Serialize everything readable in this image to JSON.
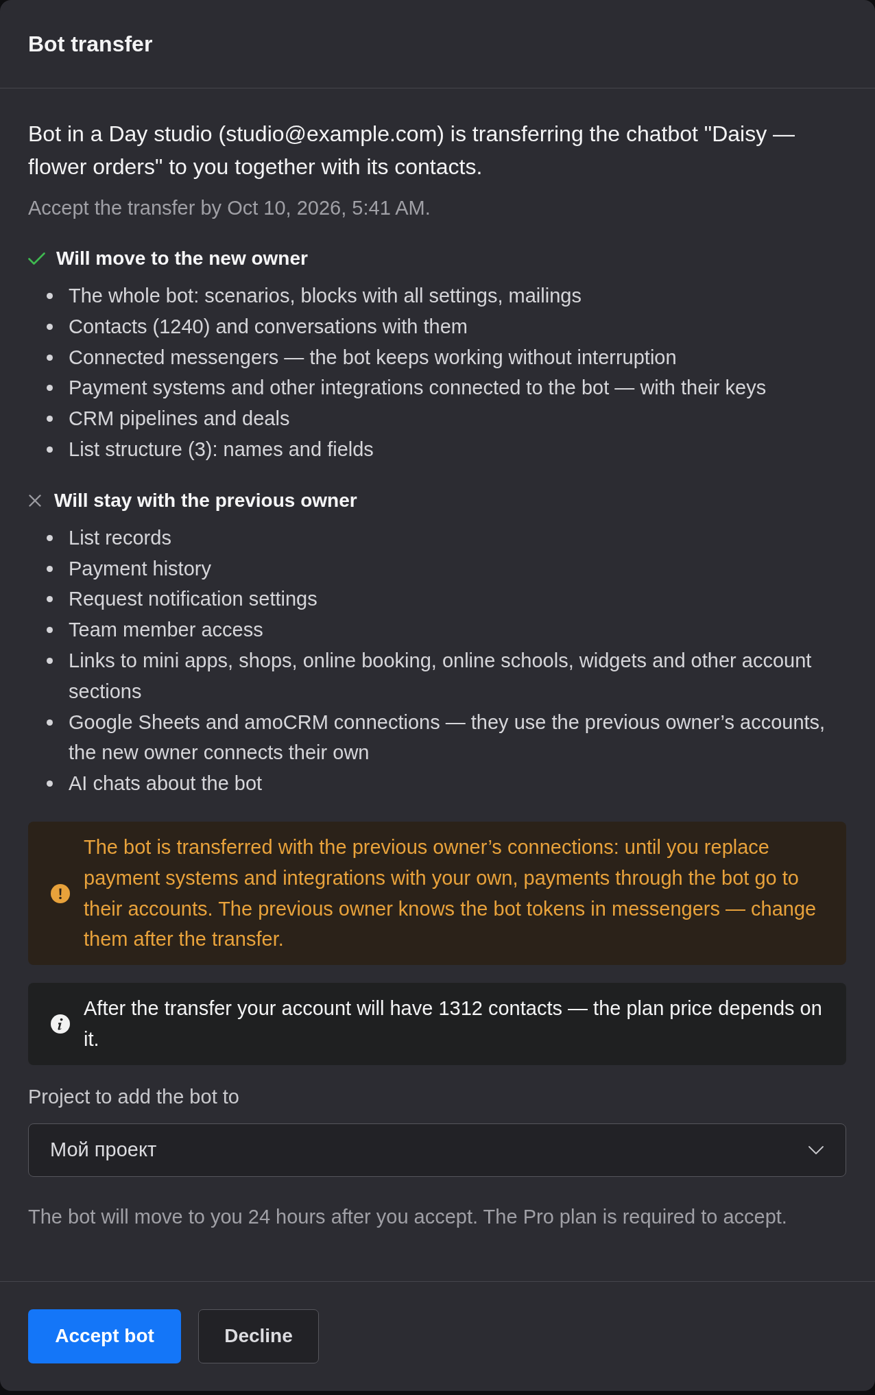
{
  "dialog": {
    "title": "Bot transfer"
  },
  "intro": {
    "message": "Bot in a Day studio (studio@example.com) is transferring the chatbot \"Daisy — flower orders\" to you together with its contacts.",
    "deadline": "Accept the transfer by Oct 10, 2026, 5:41 AM."
  },
  "sections": [
    {
      "kind": "moves",
      "heading": "Will move to the new owner",
      "items": [
        "The whole bot: scenarios, blocks with all settings, mailings",
        "Contacts (1240) and conversations with them",
        "Connected messengers — the bot keeps working without interruption",
        "Payment systems and other integrations connected to the bot — with their keys",
        "CRM pipelines and deals",
        "List structure (3): names and fields"
      ]
    },
    {
      "kind": "stays",
      "heading": "Will stay with the previous owner",
      "items": [
        "List records",
        "Payment history",
        "Request notification settings",
        "Team member access",
        "Links to mini apps, shops, online booking, online schools, widgets and other account sections",
        "Google Sheets and amoCRM connections — they use the previous owner’s accounts, the new owner connects their own",
        "AI chats about the bot"
      ]
    }
  ],
  "notices": [
    {
      "kind": "warning",
      "text": "The bot is transferred with the previous owner’s connections: until you replace payment systems and integrations with your own, payments through the bot go to their accounts. The previous owner knows the bot tokens in messengers — change them after the transfer."
    },
    {
      "kind": "info",
      "text": "After the transfer your account will have 1312 contacts — the plan price depends on it."
    }
  ],
  "project_field": {
    "label": "Project to add the bot to",
    "value": "Мой проект"
  },
  "footnote": "The bot will move to you 24 hours after you accept. The Pro plan is required to accept.",
  "buttons": [
    {
      "kind": "primary",
      "label": "Accept bot"
    },
    {
      "kind": "secondary",
      "label": "Decline"
    }
  ]
}
